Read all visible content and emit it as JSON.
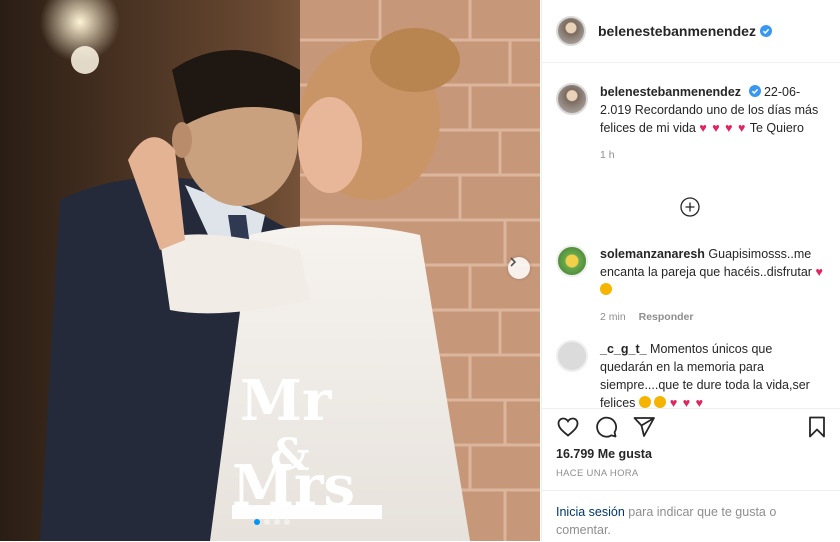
{
  "post": {
    "author": "belenestebanmenendez",
    "caption_username": "belenestebanmenendez",
    "caption_text": "22-06-2.019 Recordando uno de los días más felices de mi vida",
    "caption_hearts": "♥ ♥ ♥ ♥",
    "caption_end": "Te Quiero",
    "caption_age": "1 h",
    "photo_topper_text": "Mr & Mrs"
  },
  "comments": [
    {
      "username": "solemanzanaresh",
      "text": "Guapisimosss..me encanta la pareja que hacéis..disfrutar",
      "emoji": "♥",
      "age": "2 min",
      "reply_label": "Responder"
    },
    {
      "username": "_c_g_t_",
      "text": "Momentos únicos que quedarán en la memoria para siempre....que te dure toda la vida,ser felices",
      "emoji": "♥ ♥ ♥"
    }
  ],
  "actions": {
    "likes_count": "16.799",
    "likes_label": "Me gusta",
    "timestamp": "HACE UNA HORA"
  },
  "login": {
    "link": "Inicia sesión",
    "text": "para indicar que te gusta o comentar."
  },
  "colors": {
    "verified": "#3897f0",
    "link": "#00376b",
    "heart": "#e0245e",
    "muted": "#8e8e8e"
  }
}
